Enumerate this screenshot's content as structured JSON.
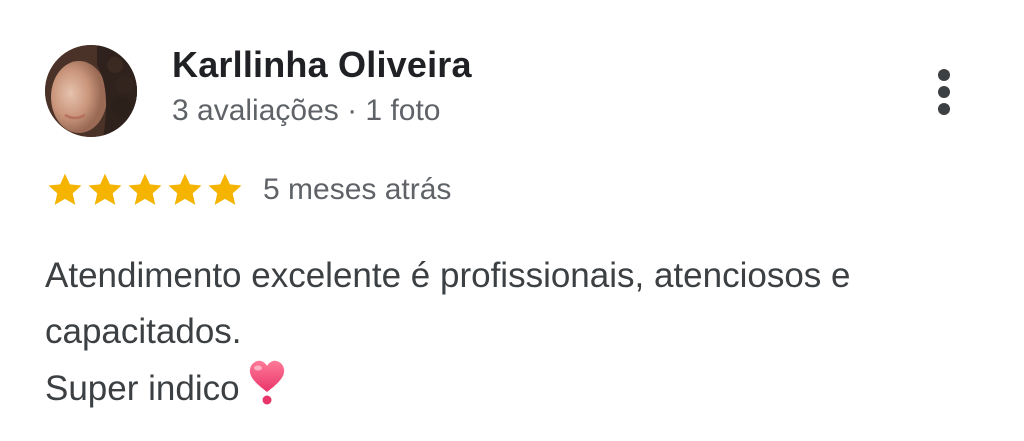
{
  "reviewer": {
    "name": "Karllinha Oliveira",
    "meta": "3 avaliações · 1 foto",
    "avatar_icon": "profile-photo"
  },
  "menu": {
    "icon": "more-vertical-icon"
  },
  "rating": {
    "stars": 5,
    "max_stars": 5,
    "star_color": "#f4b400",
    "date": "5 meses atrás"
  },
  "review": {
    "line1": "Atendimento excelente é profissionais, atenciosos e",
    "line2": "capacitados.",
    "line3": "Super indico",
    "emoji_icon": "pink-heart-exclamation-icon"
  },
  "colors": {
    "text_primary": "#202124",
    "text_secondary": "#5f6368",
    "heart": "#f0557a"
  }
}
